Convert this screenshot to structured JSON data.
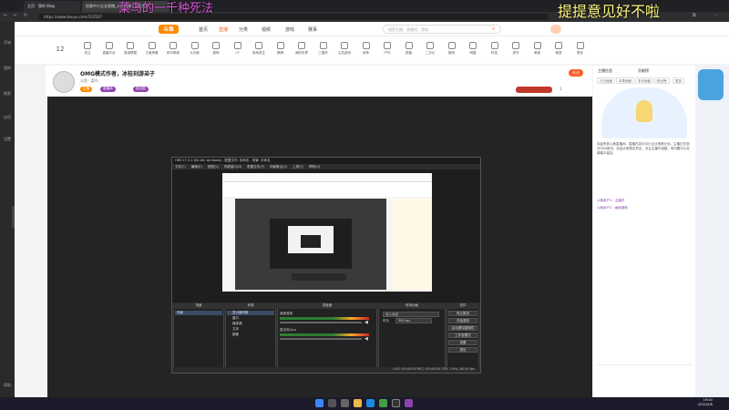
{
  "browser": {
    "tabs": [
      {
        "label": "主页 · 我的 Blog"
      },
      {
        "label": "拯救中小企业直播_斗鱼直播 - DOUYU"
      }
    ],
    "url": "https://www.douyu.com/101507",
    "toolbar_icons": [
      "back-icon",
      "forward-icon",
      "refresh-icon",
      "bookmark-icon",
      "extensions-icon",
      "menu-icon"
    ]
  },
  "overlay": {
    "left_text": "菜鸟的一千种死法",
    "right_text": "提提意见好不啦"
  },
  "os_sidebar": [
    "开始",
    "我的",
    "搜索",
    "应用",
    "设置",
    "帮助"
  ],
  "site": {
    "logo": "斗鱼",
    "nav": [
      "首页",
      "直播",
      "分类",
      "视频",
      "游戏",
      "赛事",
      "鱼吧"
    ],
    "active_nav": "直播",
    "categories": [
      "关注",
      "直播平台",
      "英雄联盟",
      "王者荣耀",
      "和平精英",
      "大天使",
      "原神",
      "CF",
      "绝地求生",
      "棋牌",
      "我的世界",
      "三国杀",
      "主机游戏",
      "体育",
      "户外",
      "颜值",
      "二次元",
      "数码",
      "明星",
      "科技",
      "虎牙",
      "美食",
      "萌宠",
      "更多"
    ],
    "search_placeholder": "搜索主播、直播间、游戏"
  },
  "room": {
    "level": "12",
    "title": "OMG模式作者，冰桂刻游弟子",
    "anchor": "斗鱼 · 菜鸟",
    "subscribe": "关注",
    "tags": [
      "主播",
      "直播间",
      "粉丝团"
    ],
    "viewer_count": "1"
  },
  "rightbar": {
    "tabs": [
      "主播信息",
      "贡献榜"
    ],
    "subtabs": [
      "今日贡献",
      "本周贡献",
      "本月贡献",
      "粉丝榜",
      "更多"
    ],
    "announcement": "欢迎来到斗鱼直播间，直播内容为中小企业拯救计划，主播正在测试OBS推流。欢迎大家提出意见，关注主播不迷路，有问题可以在弹幕中留言。",
    "chat": [
      {
        "user": "斗鱼用户1",
        "text": "主播好"
      },
      {
        "user": "斗鱼用户2",
        "text": "画面清晰"
      }
    ]
  },
  "obs": {
    "title": "OBS 27.2.4 (64-bit, windows) - 配置文件: 未命名 - 场景: 未命名",
    "menu": [
      "文件(F)",
      "编辑(E)",
      "视图(V)",
      "停靠窗口(D)",
      "配置文件(P)",
      "场景集合(S)",
      "工具(T)",
      "帮助(H)"
    ],
    "docks": {
      "scenes": "场景",
      "sources": "来源",
      "mixer": "混音器",
      "transitions": "转场动画",
      "controls": "控件"
    },
    "scene_items": [
      "场景"
    ],
    "sources": [
      "显示器采集",
      "窗口",
      "媒体源",
      "文本",
      "图像"
    ],
    "mixer_channels": [
      "桌面音频",
      "麦克风/Aux"
    ],
    "transition": "淡入淡出",
    "duration_label": "时长",
    "duration": "300 ms",
    "controls": [
      "停止推流",
      "开始录制",
      "启动虚拟摄像机",
      "工作室模式",
      "设置",
      "退出"
    ],
    "status": "LIVE: 00:00:00  REC: 00:00:00  CPU: 3.9%, 60.00 fps"
  },
  "taskbar": {
    "time": "19:00",
    "date": "2022/5/8"
  },
  "colors": {
    "accent": "#ff5d23",
    "obs_bg": "#2b2b2b",
    "overlay_yellow": "#fdf37c",
    "overlay_pink": "#d857d6"
  }
}
